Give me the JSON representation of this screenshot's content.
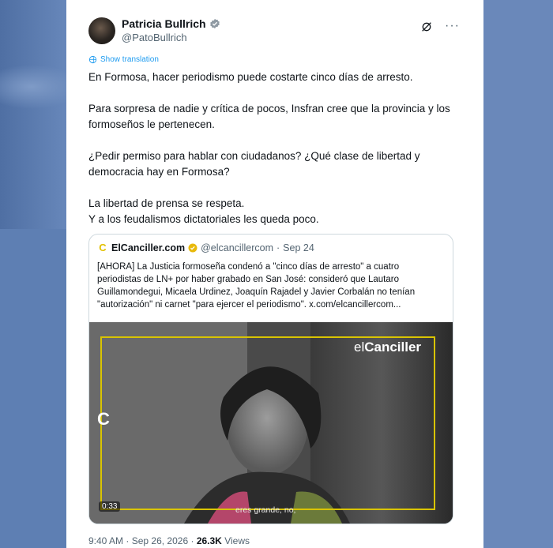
{
  "post": {
    "author_name": "Patricia Bullrich",
    "author_handle": "@PatoBullrich",
    "show_translation": "Show translation",
    "text": [
      "En Formosa, hacer periodismo puede costarte cinco días de arresto.",
      "Para sorpresa de nadie y crítica de pocos, Insfran cree que la provincia y los formoseños le pertenecen.",
      "¿Pedir permiso para hablar con ciudadanos? ¿Qué clase de libertad y democracia hay en Formosa?",
      "La libertad de prensa se respeta.",
      "Y a los feudalismos dictatoriales les queda poco."
    ],
    "time": "9:40 AM",
    "separator": "·",
    "date": "Sep 26, 2026",
    "views_count": "26.3K",
    "views_label": "Views"
  },
  "quote": {
    "avatar_letter": "C",
    "name": "ElCanciller.com",
    "handle": "@elcancillercom",
    "separator": "·",
    "date": "Sep 24",
    "text": "[AHORA] La Justicia formoseña condenó a \"cinco días de arresto\" a cuatro periodistas de LN+ por haber grabado en San José: consideró que Lautaro Guillamondegui, Micaela Urdinez, Joaquín Rajadel y Javier Corbalán no tenían \"autorización\" ni carnet \"para ejercer el periodismo\". x.com/elcancillercom...",
    "media": {
      "logo_prefix": "el",
      "logo_bold": "Canciller",
      "side_letter": "C",
      "duration": "0:33",
      "caption": "eres grande, no,"
    }
  },
  "icons": {
    "verified": "verified-badge-icon",
    "grok": "grok-icon",
    "more": "more-icon",
    "translate": "translate-icon",
    "gold_badge": "gold-verified-icon"
  },
  "colors": {
    "link": "#1d9bf0",
    "muted": "#536471",
    "frame": "#d9c400"
  }
}
